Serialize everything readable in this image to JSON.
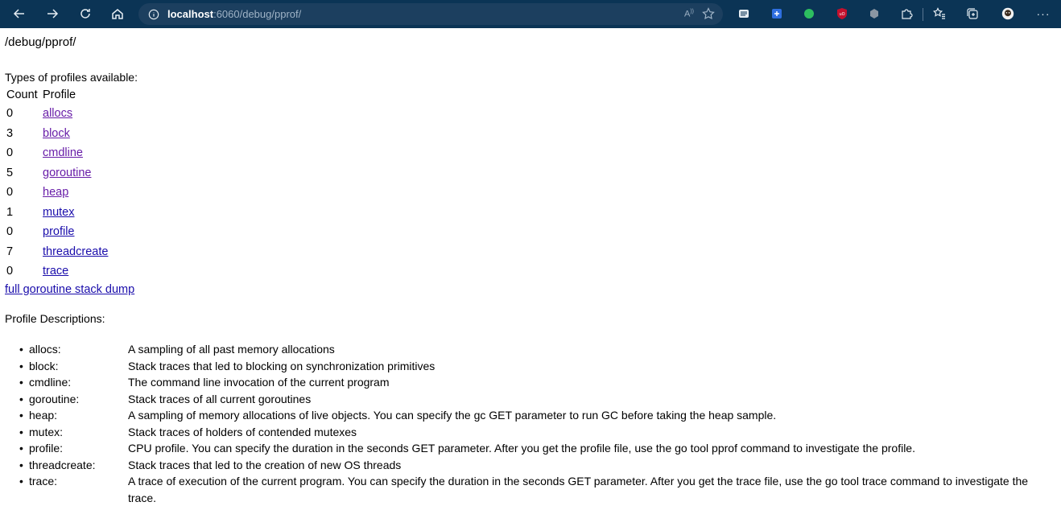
{
  "browser": {
    "url_host": "localhost",
    "url_path": ":6060/debug/pprof/"
  },
  "page": {
    "path": "/debug/pprof/",
    "types_label": "Types of profiles available:",
    "table_headers": {
      "count": "Count",
      "profile": "Profile"
    },
    "profiles": [
      {
        "count": "0",
        "name": "allocs",
        "visited": true
      },
      {
        "count": "3",
        "name": "block",
        "visited": true
      },
      {
        "count": "0",
        "name": "cmdline",
        "visited": true
      },
      {
        "count": "5",
        "name": "goroutine",
        "visited": true
      },
      {
        "count": "0",
        "name": "heap",
        "visited": true
      },
      {
        "count": "1",
        "name": "mutex",
        "visited": false
      },
      {
        "count": "0",
        "name": "profile",
        "visited": false
      },
      {
        "count": "7",
        "name": "threadcreate",
        "visited": false
      },
      {
        "count": "0",
        "name": "trace",
        "visited": false
      }
    ],
    "full_dump_link": "full goroutine stack dump",
    "descriptions_label": "Profile Descriptions:",
    "descriptions": [
      {
        "name": "allocs:",
        "text": "A sampling of all past memory allocations"
      },
      {
        "name": "block:",
        "text": "Stack traces that led to blocking on synchronization primitives"
      },
      {
        "name": "cmdline:",
        "text": "The command line invocation of the current program"
      },
      {
        "name": "goroutine:",
        "text": "Stack traces of all current goroutines"
      },
      {
        "name": "heap:",
        "text": "A sampling of memory allocations of live objects. You can specify the gc GET parameter to run GC before taking the heap sample."
      },
      {
        "name": "mutex:",
        "text": "Stack traces of holders of contended mutexes"
      },
      {
        "name": "profile:",
        "text": "CPU profile. You can specify the duration in the seconds GET parameter. After you get the profile file, use the go tool pprof command to investigate the profile."
      },
      {
        "name": "threadcreate:",
        "text": "Stack traces that led to the creation of new OS threads"
      },
      {
        "name": "trace:",
        "text": "A trace of execution of the current program. You can specify the duration in the seconds GET parameter. After you get the trace file, use the go tool trace command to investigate the trace."
      }
    ]
  },
  "colors": {
    "chrome_bg": "#0b3455",
    "link": "#1a0dab",
    "link_visited": "#681da8"
  }
}
